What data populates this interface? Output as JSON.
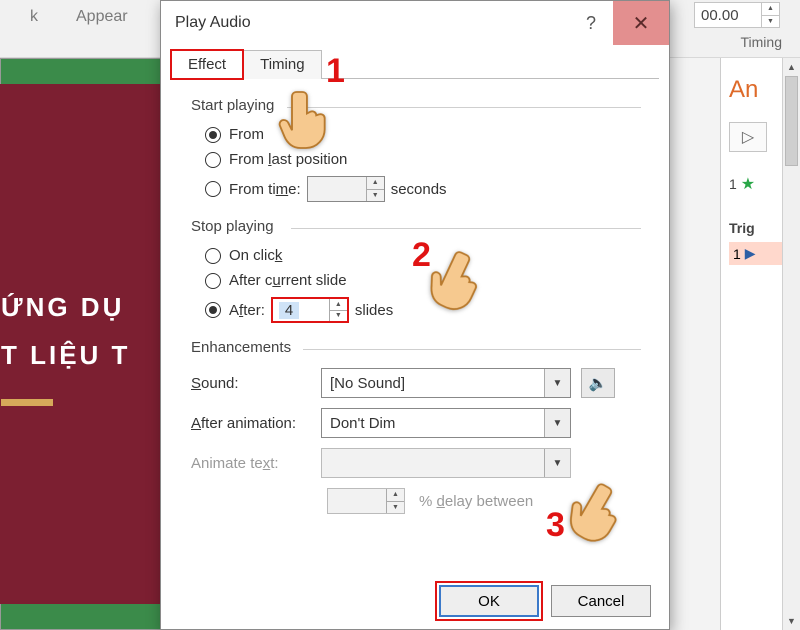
{
  "ribbon": {
    "left1": "k",
    "left2": "Appear",
    "timing_value": "00.00",
    "timing_label": "Timing"
  },
  "slide": {
    "line1": "ỨNG DỤ",
    "line2": "T LIỆU T"
  },
  "anim_pane": {
    "title": "An",
    "item1_num": "1",
    "trigger_label": "Trig",
    "item2_num": "1"
  },
  "dialog": {
    "title": "Play Audio",
    "tabs": {
      "effect": "Effect",
      "timing": "Timing"
    },
    "start_playing": {
      "legend": "Start playing",
      "from_beginning": "From",
      "from_last": "From last position",
      "from_time": "From time:",
      "from_time_value": "",
      "seconds": "seconds"
    },
    "stop_playing": {
      "legend": "Stop playing",
      "on_click": "On click",
      "after_current": "After current slide",
      "after": "After:",
      "after_value": "4",
      "slides": "slides"
    },
    "enhancements": {
      "legend": "Enhancements",
      "sound_label": "Sound:",
      "sound_value": "[No Sound]",
      "after_anim_label": "After animation:",
      "after_anim_value": "Don't Dim",
      "animate_text_label": "Animate text:",
      "animate_text_value": "",
      "delay_value": "",
      "delay_label": "% delay between"
    },
    "buttons": {
      "ok": "OK",
      "cancel": "Cancel"
    }
  },
  "annotations": {
    "n1": "1",
    "n2": "2",
    "n3": "3"
  }
}
